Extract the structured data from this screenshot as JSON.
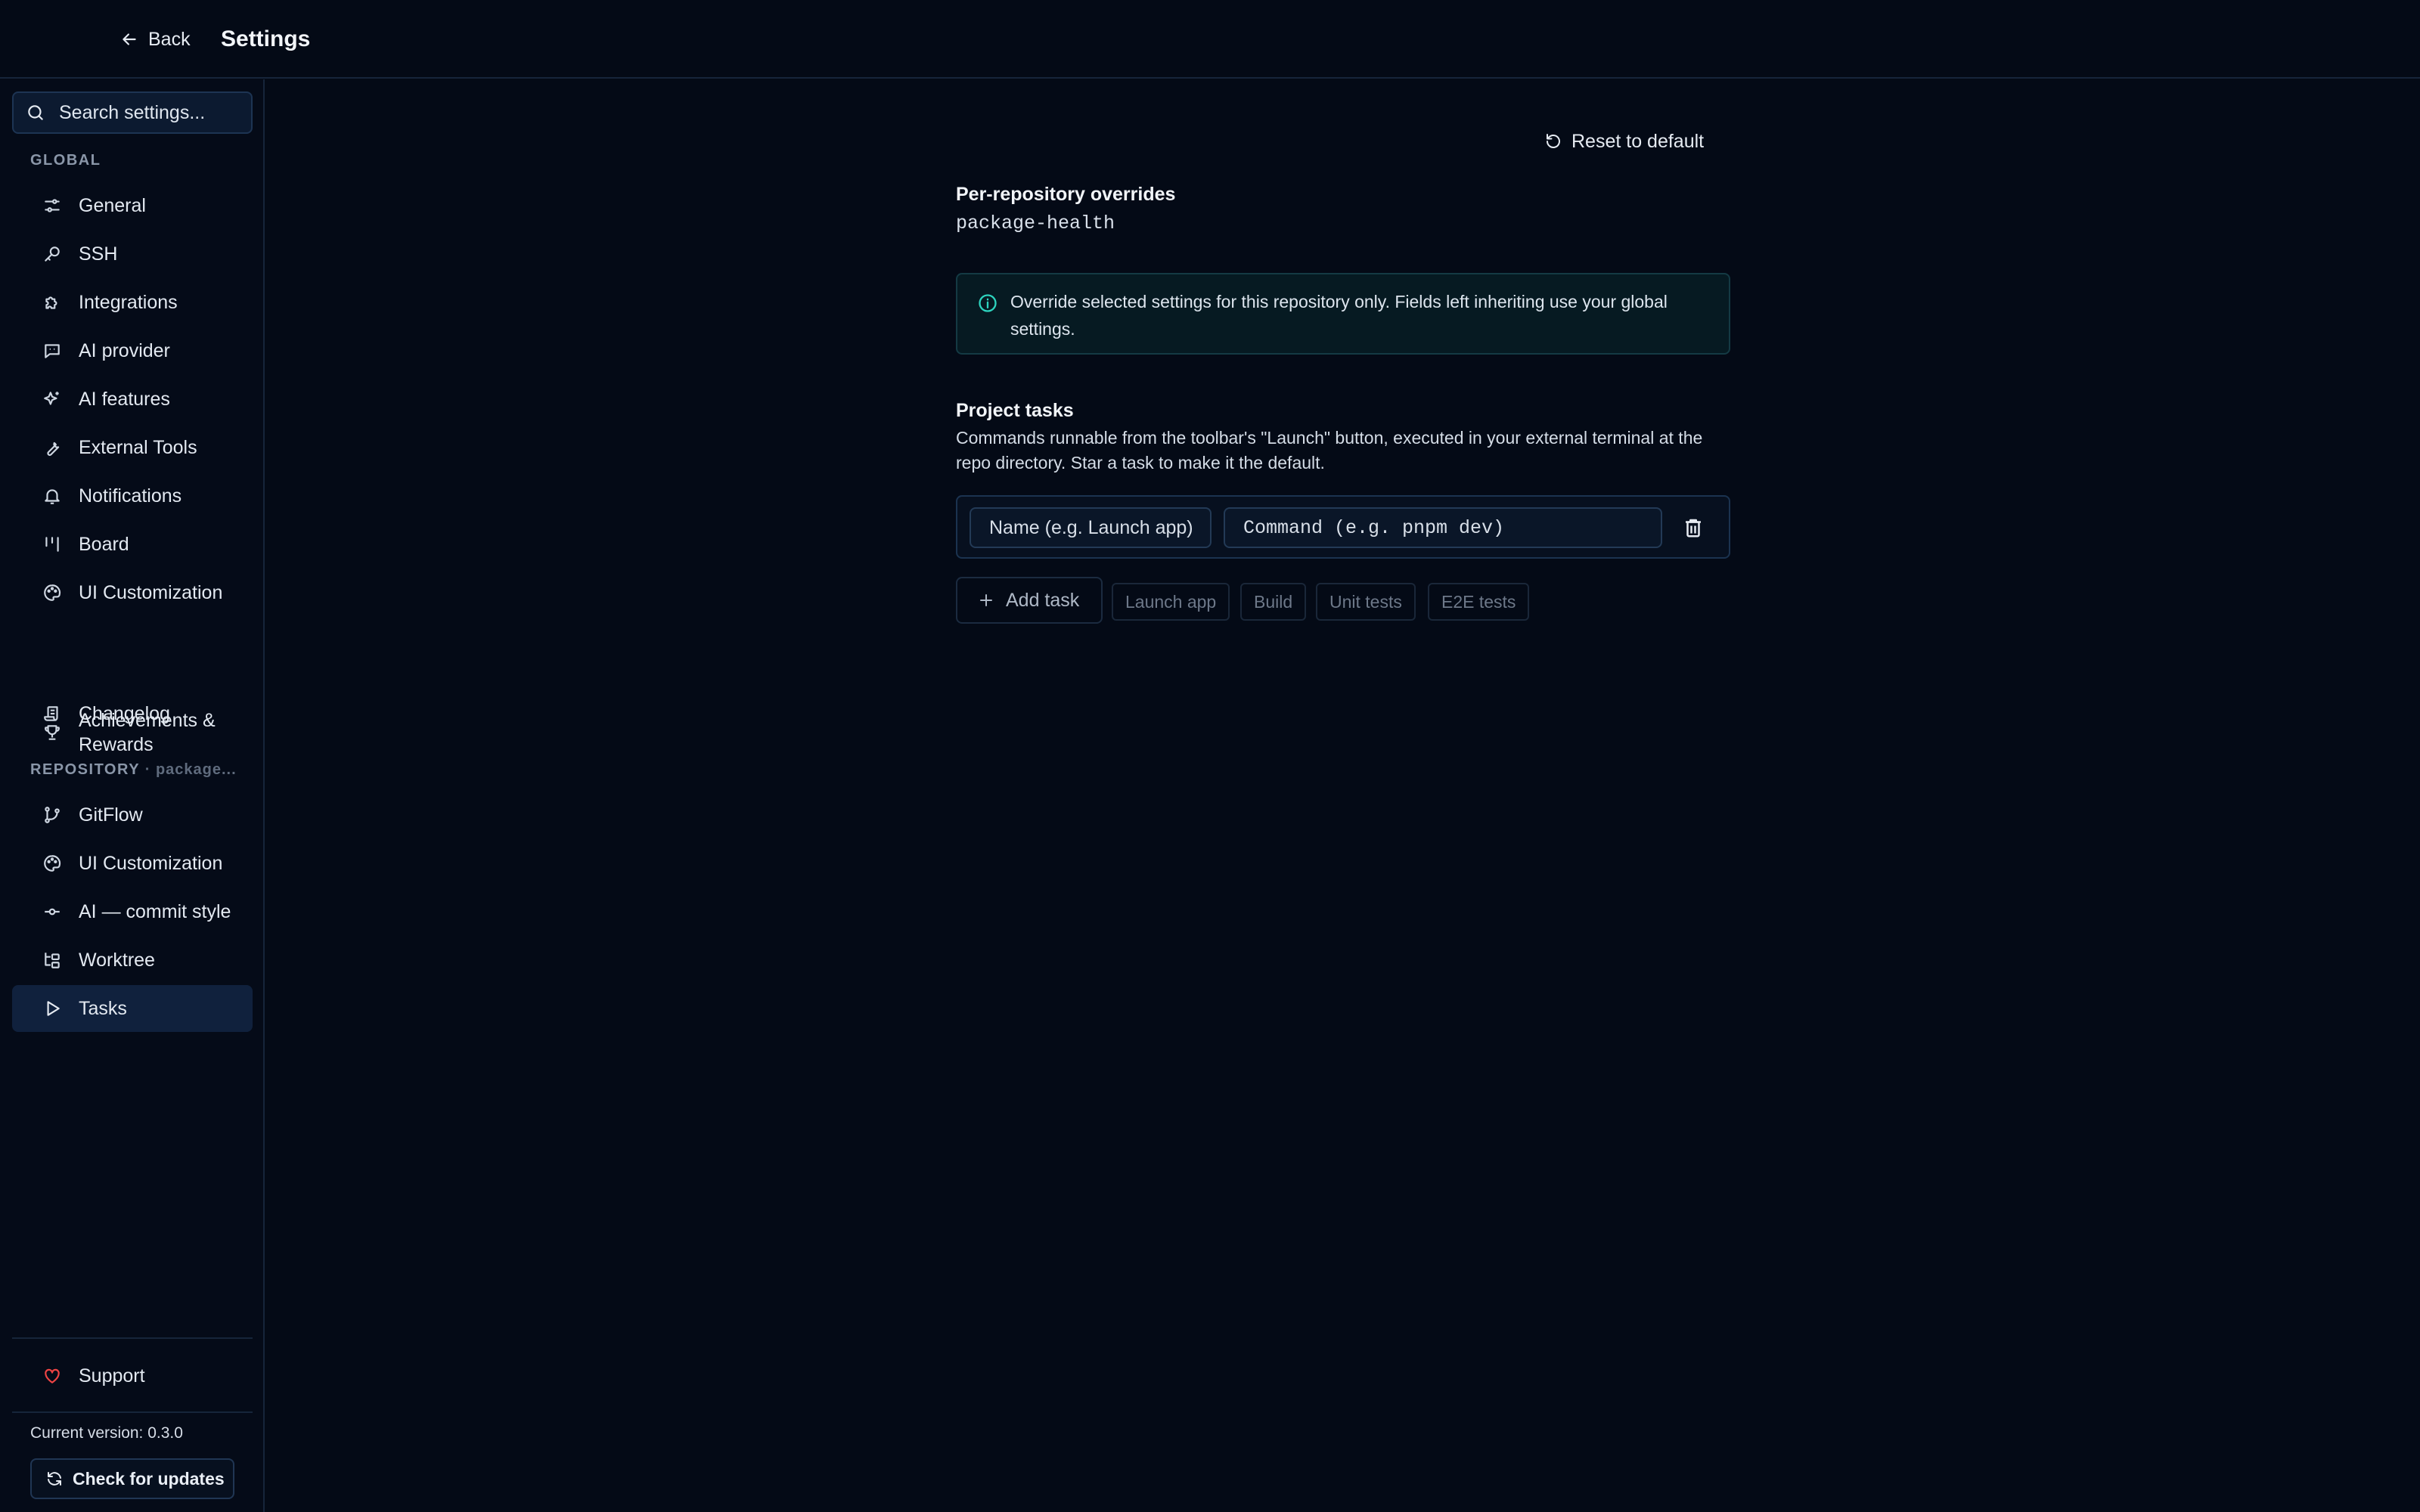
{
  "header": {
    "back_label": "Back",
    "title": "Settings"
  },
  "sidebar": {
    "search_placeholder": "Search settings...",
    "global_label": "GLOBAL",
    "global_items": [
      {
        "label": "General",
        "icon": "sliders-icon"
      },
      {
        "label": "SSH",
        "icon": "key-icon"
      },
      {
        "label": "Integrations",
        "icon": "puzzle-icon"
      },
      {
        "label": "AI provider",
        "icon": "chat-icon"
      },
      {
        "label": "AI features",
        "icon": "sparkles-icon"
      },
      {
        "label": "External Tools",
        "icon": "wrench-icon"
      },
      {
        "label": "Notifications",
        "icon": "bell-icon"
      },
      {
        "label": "Board",
        "icon": "kanban-icon"
      },
      {
        "label": "UI Customization",
        "icon": "palette-icon"
      },
      {
        "label": "Achievements & Rewards",
        "icon": "trophy-icon"
      },
      {
        "label": "Changelog",
        "icon": "scroll-icon"
      }
    ],
    "repo_label": "REPOSITORY",
    "repo_sub": "· package...",
    "repo_items": [
      {
        "label": "GitFlow",
        "icon": "git-branch-icon"
      },
      {
        "label": "UI Customization",
        "icon": "palette-icon"
      },
      {
        "label": "AI — commit style",
        "icon": "git-commit-icon"
      },
      {
        "label": "Worktree",
        "icon": "folder-tree-icon"
      },
      {
        "label": "Tasks",
        "icon": "play-icon",
        "active": true
      }
    ],
    "support_label": "Support",
    "version_text": "Current version: 0.3.0",
    "check_updates_label": "Check for updates"
  },
  "main": {
    "reset_label": "Reset to default",
    "overrides_title": "Per-repository overrides",
    "repo_name": "package-health",
    "info_text": "Override selected settings for this repository only. Fields left inheriting use your global settings.",
    "tasks_title": "Project tasks",
    "tasks_desc": "Commands runnable from the toolbar's \"Launch\" button, executed in your external terminal at the repo directory. Star a task to make it the default.",
    "name_placeholder": "Name (e.g. Launch app)",
    "command_placeholder": "Command (e.g. pnpm dev)",
    "add_task_label": "Add task",
    "presets": [
      "Launch app",
      "Build",
      "Unit tests",
      "E2E tests"
    ]
  },
  "colors": {
    "background": "#040a16",
    "active_item": "#10213d",
    "info_accent": "#2dd4bf",
    "support_heart": "#ef4444"
  }
}
